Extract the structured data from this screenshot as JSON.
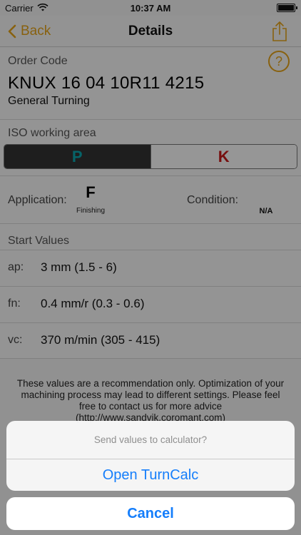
{
  "status_bar": {
    "carrier": "Carrier",
    "time": "10:37 AM",
    "wifi_icon": "wifi-icon",
    "battery_icon": "battery-icon"
  },
  "nav": {
    "back_label": "Back",
    "title": "Details",
    "share_icon": "share-icon",
    "accent_color": "#e3a21a"
  },
  "order": {
    "label": "Order Code",
    "code": "KNUX 16 04 10R11 4215",
    "subtitle": "General Turning",
    "help_label": "?"
  },
  "iso": {
    "label": "ISO working area",
    "options": [
      "P",
      "K"
    ],
    "selected": "P",
    "colors": {
      "P": "#0aa6ad",
      "K": "#c61a1a"
    }
  },
  "application": {
    "label": "Application:",
    "letter": "F",
    "description": "Finishing"
  },
  "condition": {
    "label": "Condition:",
    "value": "N/A"
  },
  "start_values": {
    "label": "Start Values",
    "rows": [
      {
        "key": "ap:",
        "value": "3 mm (1.5 - 6)"
      },
      {
        "key": "fn:",
        "value": "0.4 mm/r (0.3 - 0.6)"
      },
      {
        "key": "vc:",
        "value": "370 m/min (305 - 415)"
      }
    ]
  },
  "disclaimer": "These values are a recommendation only. Optimization of your machining process may lead to different settings. Please feel free to contact us for more advice (http://www.sandvik.coromant.com)",
  "action_sheet": {
    "title": "Send values to calculator?",
    "action": "Open TurnCalc",
    "cancel": "Cancel",
    "action_color": "#157efb"
  }
}
